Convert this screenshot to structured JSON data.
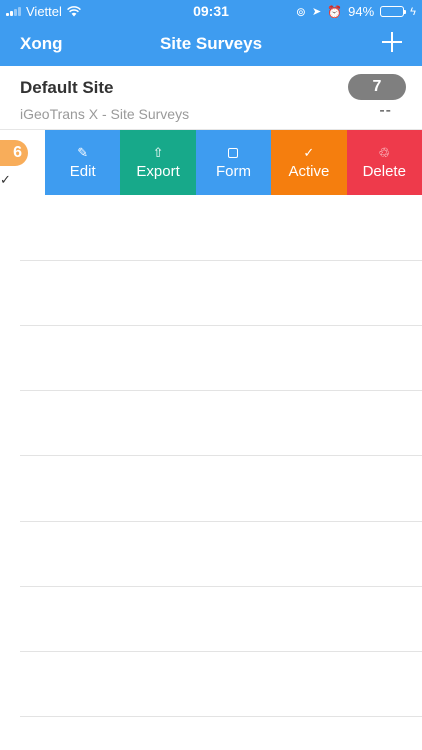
{
  "status_bar": {
    "carrier": "Viettel",
    "time": "09:31",
    "battery": "94%",
    "battery_level": 0.94
  },
  "nav": {
    "back_label": "Xong",
    "title": "Site Surveys",
    "add_icon": "plus-icon"
  },
  "rows": [
    {
      "name": "Default Site",
      "subtitle": "iGeoTrans X - Site Surveys",
      "badge": "7",
      "detail": "--"
    },
    {
      "badge_peek": "6",
      "check_peek": "✓"
    }
  ],
  "actions": {
    "edit": {
      "label": "Edit",
      "icon": "✎"
    },
    "export": {
      "label": "Export",
      "icon": "⇧"
    },
    "form": {
      "label": "Form",
      "icon": "square-icon"
    },
    "active": {
      "label": "Active",
      "icon": "✓"
    },
    "delete": {
      "label": "Delete",
      "icon": "♲"
    }
  },
  "colors": {
    "primary": "#3e9cf0",
    "export": "#17a98a",
    "active": "#f57e0e",
    "delete": "#ee3a4b",
    "badge_gray": "#7f7f7f",
    "badge_orange": "#f8ad5a"
  }
}
